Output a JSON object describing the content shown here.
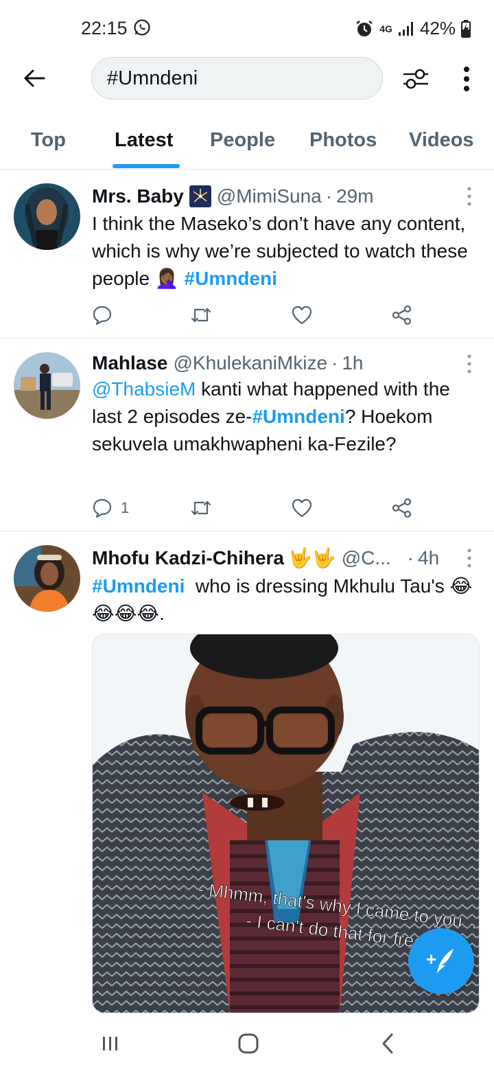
{
  "status_bar": {
    "time": "22:15",
    "network": "4G",
    "battery": "42%",
    "icons": [
      "whatsapp-icon",
      "alarm-icon",
      "signal-icon",
      "battery-charging-icon"
    ]
  },
  "search": {
    "query": "#Umndeni"
  },
  "tabs": [
    {
      "label": "Top",
      "active": false
    },
    {
      "label": "Latest",
      "active": true
    },
    {
      "label": "People",
      "active": false
    },
    {
      "label": "Photos",
      "active": false
    },
    {
      "label": "Videos",
      "active": false
    }
  ],
  "tweets": [
    {
      "name": "Mrs. Baby",
      "handle": "@MimiSuna",
      "dot": "·",
      "time": "29m",
      "text": "I think the Maseko’s don’t have any content, which is why we’re subjected to watch these people",
      "emoji": "🤦🏾‍♀️",
      "hashtag": "#Umndeni",
      "reply_count": ""
    },
    {
      "name": "Mahlase",
      "handle": "@KhulekaniMkize",
      "dot": "·",
      "time": "1h",
      "mention": "@ThabsieM",
      "text_a": " kanti what happened with the last 2 episodes ze-",
      "hashtag": "#Umndeni",
      "text_b": "? Hoekom sekuvela umakhwapheni ka-Fezile?",
      "reply_count": "1"
    },
    {
      "name": "Mhofu Kadzi-Chihera",
      "name_emoji": "🤟🤟",
      "handle": "@C...",
      "dot": "·",
      "time": "4h",
      "hashtag": "#Umndeni",
      "text": "  who is dressing Mkhulu Tau's",
      "trail_emoji": "😂😂😂😂.",
      "media": {
        "subtitle_line1": "- Mhmm, that's why I came to you...",
        "subtitle_line2": "- I can't do that for free."
      }
    }
  ],
  "fab": {
    "icon": "compose-tweet-icon",
    "symbol": "+"
  },
  "colors": {
    "accent": "#1d9bf0",
    "text": "#0f1419",
    "secondary": "#536471",
    "divider": "#e1e8ed"
  }
}
